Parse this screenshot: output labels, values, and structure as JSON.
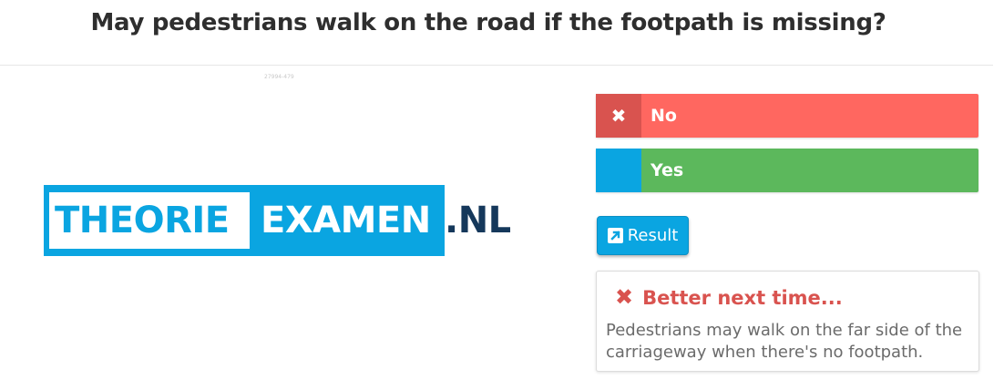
{
  "question": {
    "title": "May pedestrians walk on the road if the footpath is missing?",
    "image_id": "27994-479"
  },
  "logo": {
    "part1": "THEORIE",
    "part2": "EXAMEN",
    "part3": ".NL",
    "colors": {
      "blue": "#0aa5e1",
      "navy": "#15385b"
    }
  },
  "answers": [
    {
      "label": "No",
      "state": "wrong",
      "marker_icon": "close-icon",
      "marker_glyph": "✖"
    },
    {
      "label": "Yes",
      "state": "correct",
      "marker_glyph": ""
    }
  ],
  "result_button": {
    "label": "Result",
    "icon": "external-link-icon"
  },
  "feedback": {
    "icon": "close-icon",
    "icon_glyph": "✖",
    "title": "Better next time...",
    "text": "Pedestrians may walk on the far side of the carriageway when there's no footpath."
  },
  "colors": {
    "wrong": "#ff6760",
    "wrong_dark": "#d9534f",
    "correct": "#5cb85c",
    "accent": "#0aa5e1"
  }
}
